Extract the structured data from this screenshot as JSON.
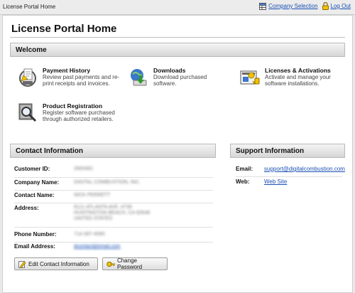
{
  "header": {
    "app_title": "License Portal Home",
    "company_selection_label": "Company Selection",
    "logout_label": "Log Out"
  },
  "page": {
    "title": "License Portal Home"
  },
  "welcome": {
    "title": "Welcome",
    "cards": [
      {
        "title": "Payment History",
        "desc": "Review past payments and re-print receipts and invoices.",
        "icon": "receipt-icon"
      },
      {
        "title": "Downloads",
        "desc": "Download purchased software.",
        "icon": "download-icon"
      },
      {
        "title": "Licenses & Activations",
        "desc": "Activate and manage your software installations.",
        "icon": "license-icon"
      },
      {
        "title": "Product Registration",
        "desc": "Register software purchased through authorized retailers.",
        "icon": "registration-icon"
      }
    ]
  },
  "contact": {
    "title": "Contact Information",
    "labels": {
      "customer_id": "Customer ID:",
      "company_name": "Company Name:",
      "contact_name": "Contact Name:",
      "address": "Address:",
      "phone": "Phone Number:",
      "email": "Email Address:"
    },
    "values": {
      "customer_id": "2600481",
      "company_name": "DIGITAL COMBUSTION, INC.",
      "contact_name": "NICK PERRETT",
      "address_line1": "8121 ATLANTA AVE. #739",
      "address_line2": "HUNTINGTON BEACH, CA 92646",
      "address_line3": "UNITED STATES",
      "phone": "714-397-4085",
      "email": "dcontact@email.com"
    },
    "edit_button": "Edit Contact Information",
    "password_button": "Change Password"
  },
  "support": {
    "title": "Support Information",
    "email_label": "Email:",
    "email_value": "support@digitalcombustion.com",
    "web_label": "Web:",
    "web_value": "Web Site"
  },
  "colors": {
    "link": "#1a4fb4",
    "header_bg": "#d6d6d6"
  }
}
